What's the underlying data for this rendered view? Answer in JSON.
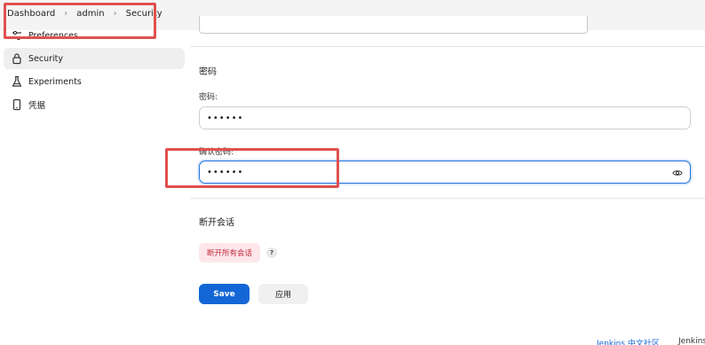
{
  "breadcrumb": [
    "Dashboard",
    "admin",
    "Security"
  ],
  "sidebar": {
    "items": [
      {
        "label": "Preferences",
        "icon": "sliders-icon"
      },
      {
        "label": "Security",
        "icon": "lock-icon",
        "active": true
      },
      {
        "label": "Experiments",
        "icon": "flask-icon"
      },
      {
        "label": "凭据",
        "icon": "phone-icon"
      }
    ]
  },
  "password_section": {
    "title": "密码",
    "password_label": "密码:",
    "password_value": "••••••",
    "confirm_label": "确认密码:",
    "confirm_value": "••••••"
  },
  "sessions_section": {
    "title": "断开会话",
    "terminate_button": "断开所有会话",
    "help_icon": "?"
  },
  "actions": {
    "save": "Save",
    "apply": "应用"
  },
  "footer": {
    "community_link": "Jenkins 中文社区",
    "version": "Jenkins"
  },
  "colors": {
    "primary": "#1466d6",
    "danger_bg": "#fde7ea",
    "danger_text": "#c4293c",
    "highlight": "#e0514f"
  }
}
